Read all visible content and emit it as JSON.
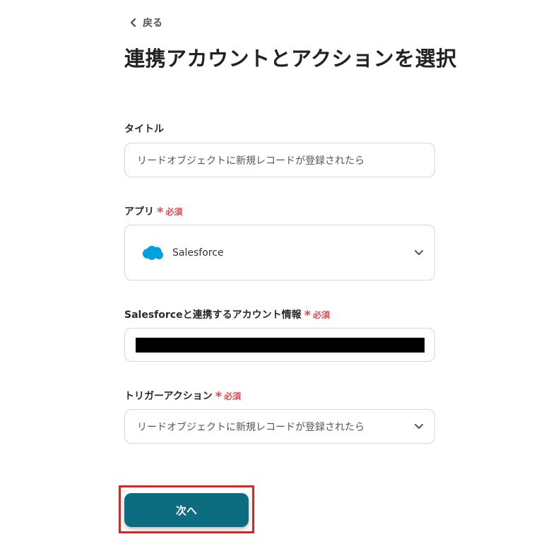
{
  "nav": {
    "back_label": "戻る"
  },
  "page_title": "連携アカウントとアクションを選択",
  "required_label": "必須",
  "form": {
    "title": {
      "label": "タイトル",
      "value": "リードオブジェクトに新規レコードが登録されたら"
    },
    "app": {
      "label": "アプリ",
      "value": "Salesforce",
      "icon": "salesforce-cloud-icon"
    },
    "account": {
      "label": "Salesforceと連携するアカウント情報",
      "value_redacted": true
    },
    "trigger": {
      "label": "トリガーアクション",
      "value": "リードオブジェクトに新規レコードが登録されたら"
    }
  },
  "actions": {
    "next_label": "次へ"
  },
  "colors": {
    "primary": "#0d6d80",
    "required": "#e5484d",
    "highlight": "#e02424",
    "salesforce": "#00a1e0"
  }
}
